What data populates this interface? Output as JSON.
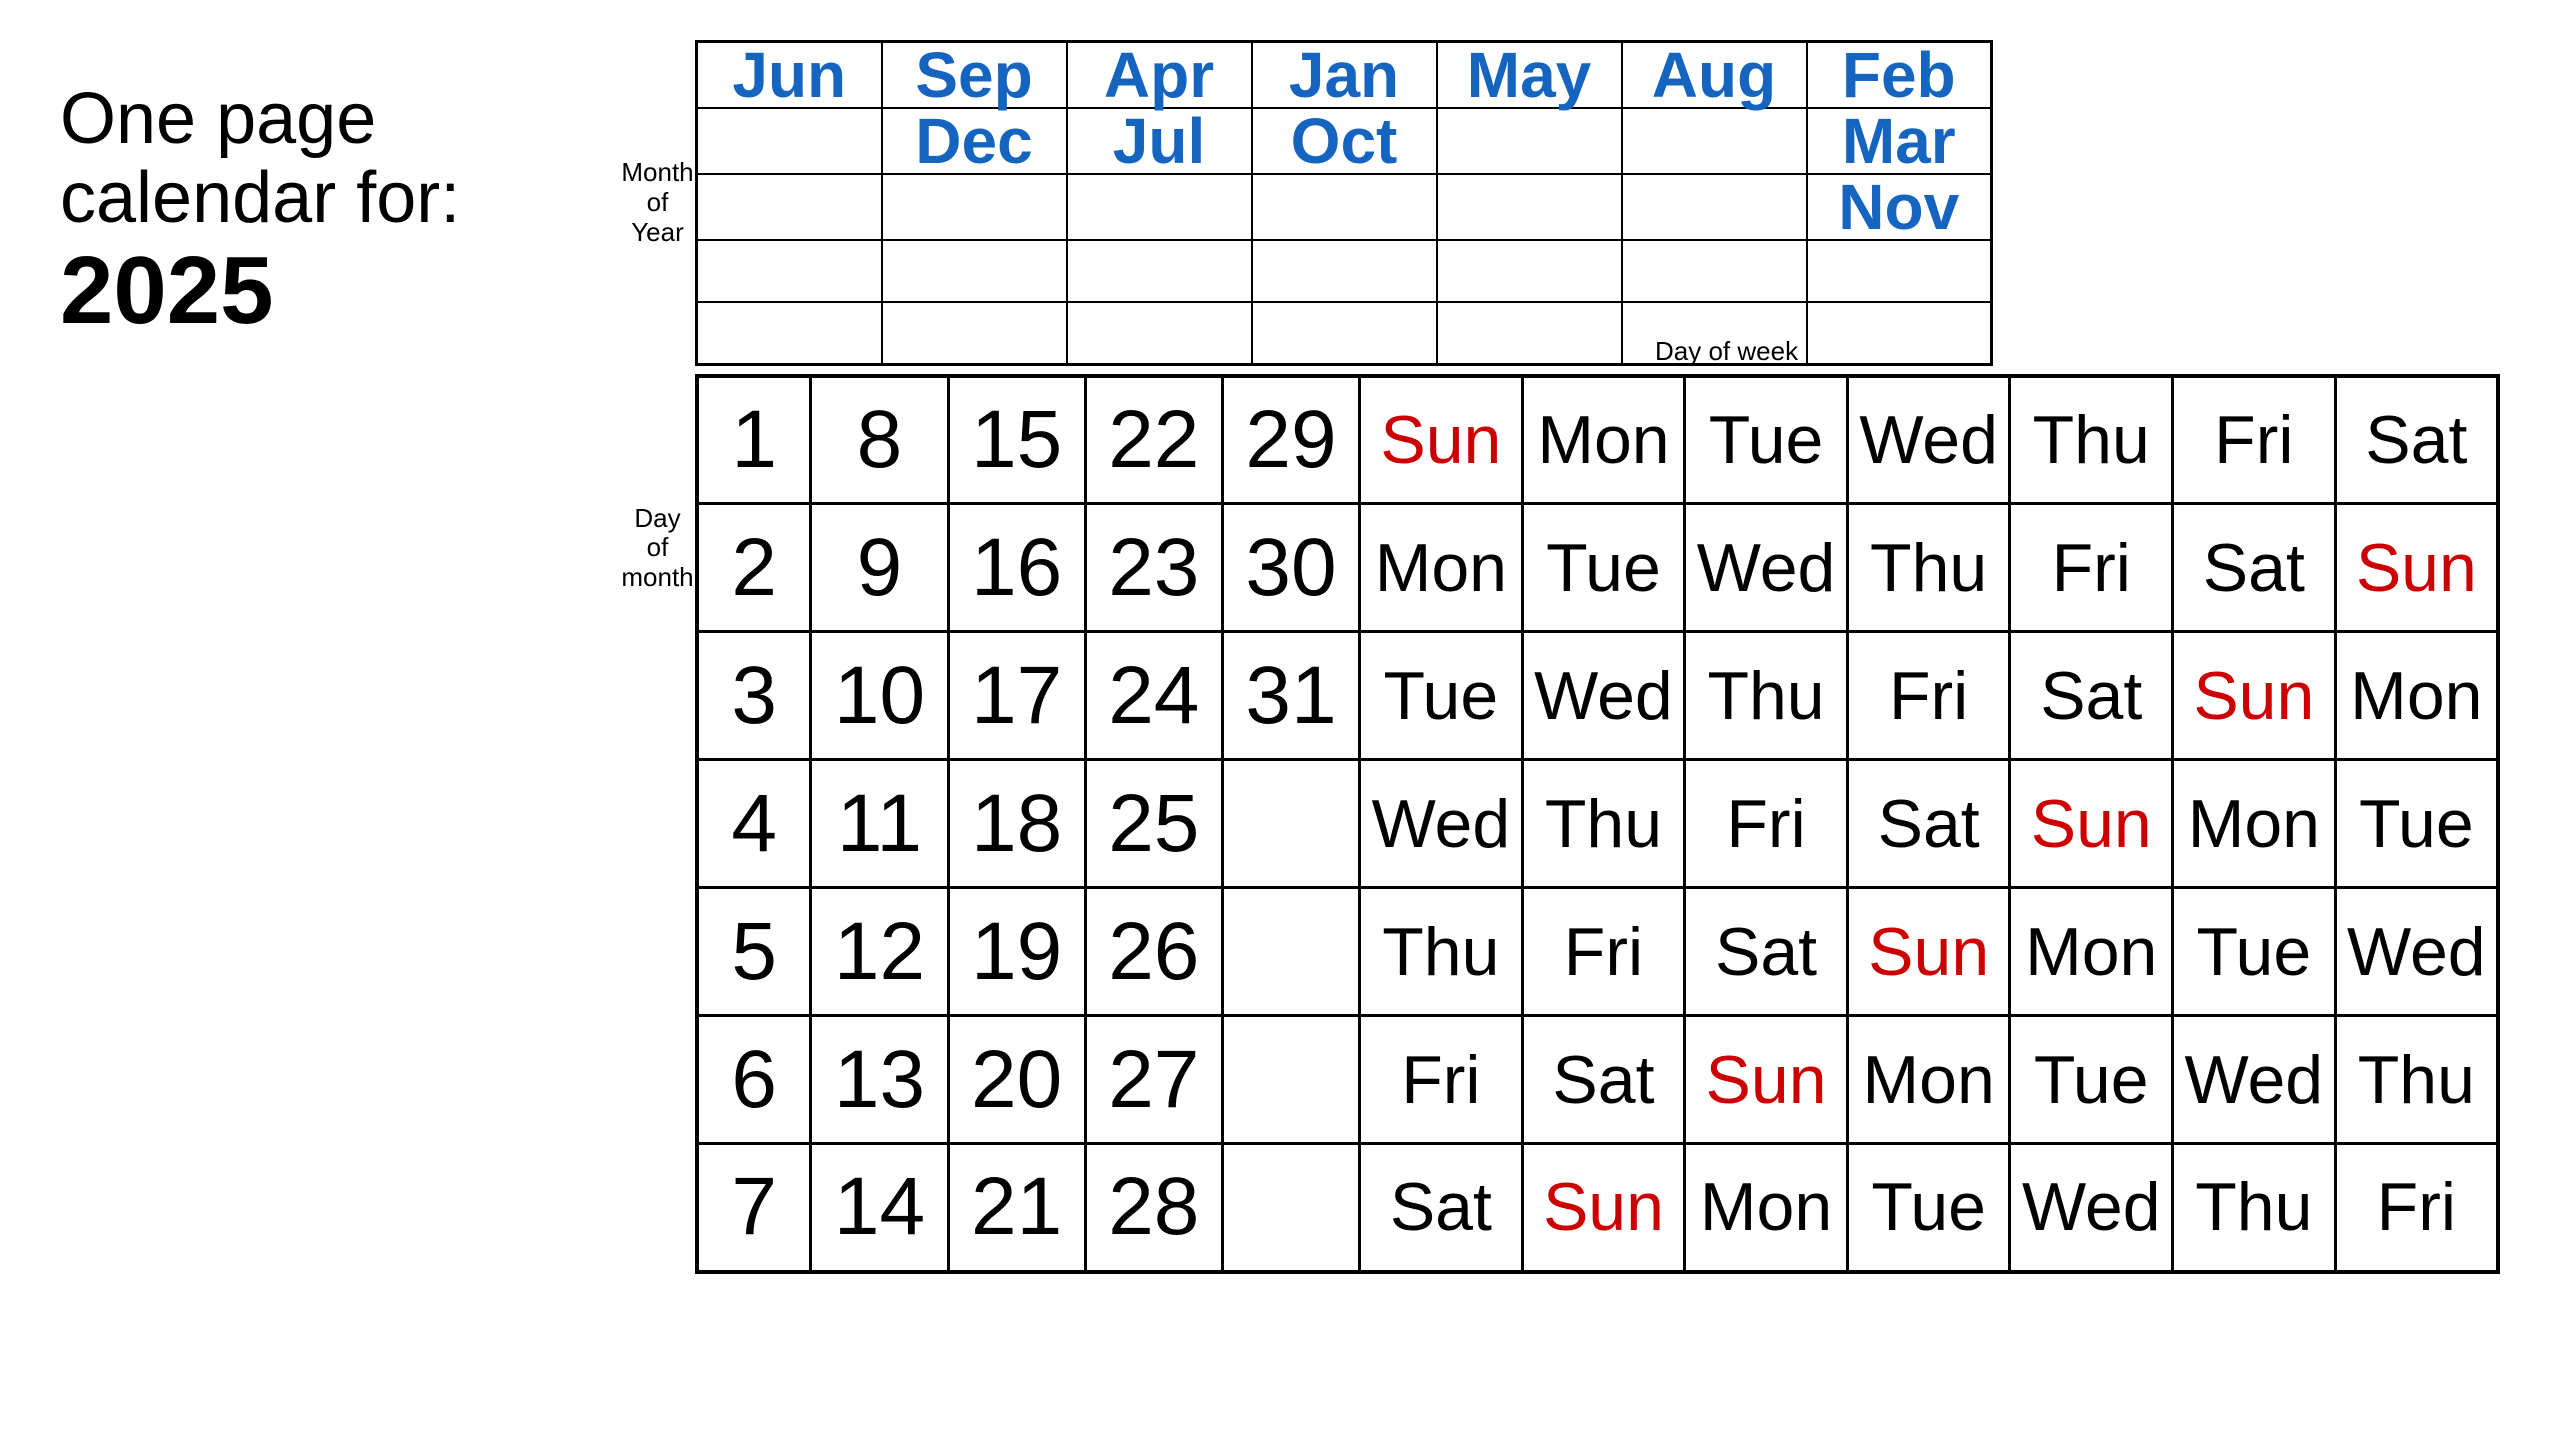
{
  "title_line1": "One page calendar for:",
  "title_year": "2025",
  "label_month_of_year": "Month\nof\nYear",
  "label_day_of_month": "Day of month",
  "label_day_of_week": "Day of week",
  "header_months": [
    [
      "Jun",
      "Sep",
      "Apr",
      "Jan",
      "May",
      "Aug",
      "Feb"
    ],
    [
      "",
      "Dec",
      "Jul",
      "Oct",
      "",
      "",
      "Mar"
    ],
    [
      "",
      "",
      "",
      "",
      "",
      "",
      "Nov"
    ],
    [
      "",
      "",
      "",
      "",
      "",
      "",
      ""
    ],
    [
      "",
      "",
      "",
      "",
      "",
      "",
      ""
    ]
  ],
  "day_numbers": [
    [
      "1",
      "8",
      "15",
      "22",
      "29"
    ],
    [
      "2",
      "9",
      "16",
      "23",
      "30"
    ],
    [
      "3",
      "10",
      "17",
      "24",
      "31"
    ],
    [
      "4",
      "11",
      "18",
      "25",
      ""
    ],
    [
      "5",
      "12",
      "19",
      "26",
      ""
    ],
    [
      "6",
      "13",
      "20",
      "27",
      ""
    ],
    [
      "7",
      "14",
      "21",
      "28",
      ""
    ]
  ],
  "day_grid": [
    [
      "Sun",
      "Mon",
      "Tue",
      "Wed",
      "Thu",
      "Fri",
      "Sat"
    ],
    [
      "Mon",
      "Tue",
      "Wed",
      "Thu",
      "Fri",
      "Sat",
      "Sun"
    ],
    [
      "Tue",
      "Wed",
      "Thu",
      "Fri",
      "Sat",
      "Sun",
      "Mon"
    ],
    [
      "Wed",
      "Thu",
      "Fri",
      "Sat",
      "Sun",
      "Mon",
      "Tue"
    ],
    [
      "Thu",
      "Fri",
      "Sat",
      "Sun",
      "Mon",
      "Tue",
      "Wed"
    ],
    [
      "Fri",
      "Sat",
      "Sun",
      "Mon",
      "Tue",
      "Wed",
      "Thu"
    ],
    [
      "Sat",
      "Sun",
      "Mon",
      "Tue",
      "Wed",
      "Thu",
      "Fri"
    ]
  ],
  "day_colors": [
    [
      "red",
      "black",
      "black",
      "black",
      "black",
      "black",
      "black"
    ],
    [
      "black",
      "black",
      "black",
      "black",
      "black",
      "black",
      "red"
    ],
    [
      "black",
      "black",
      "black",
      "black",
      "black",
      "red",
      "black"
    ],
    [
      "black",
      "black",
      "black",
      "black",
      "red",
      "black",
      "black"
    ],
    [
      "black",
      "black",
      "black",
      "red",
      "black",
      "black",
      "black"
    ],
    [
      "black",
      "black",
      "red",
      "black",
      "black",
      "black",
      "black"
    ],
    [
      "black",
      "red",
      "black",
      "black",
      "black",
      "black",
      "black"
    ]
  ]
}
